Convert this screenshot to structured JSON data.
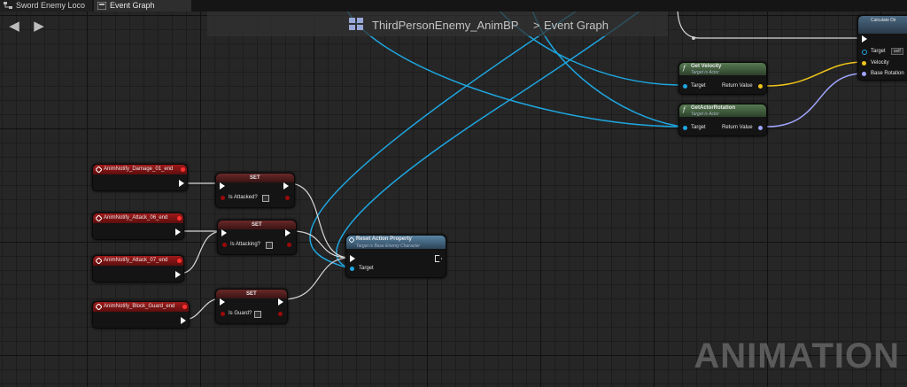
{
  "tabs": [
    {
      "label": "Sword Enemy Loco"
    },
    {
      "label": "Event Graph"
    }
  ],
  "breadcrumb": {
    "blueprint": "ThirdPersonEnemy_AnimBP",
    "separator": ">",
    "graph": "Event Graph"
  },
  "watermark": "ANIMATION",
  "nodes": {
    "events": [
      {
        "label": "AnimNotify_Damage_01_end"
      },
      {
        "label": "AnimNotify_Attack_06_end"
      },
      {
        "label": "AnimNotify_Attack_07_end"
      },
      {
        "label": "AnimNotify_Block_Guard_end"
      }
    ],
    "sets": [
      {
        "title": "SET",
        "var": "Is Attacked?"
      },
      {
        "title": "SET",
        "var": "Is Attacking?"
      },
      {
        "title": "SET",
        "var": "Is Guard?"
      }
    ],
    "reset": {
      "title": "Reset Action Property",
      "subtitle": "Target is Base Enemy Character",
      "target": "Target"
    },
    "get_velocity": {
      "icon": "f",
      "title": "Get Velocity",
      "subtitle": "Target is Actor",
      "target": "Target",
      "return": "Return Value"
    },
    "get_rotation": {
      "icon": "f",
      "title": "GetActorRotation",
      "subtitle": "Target is Actor",
      "target": "Target",
      "return": "Return Value"
    },
    "calc": {
      "title": "Calculate Dir",
      "target": "Target",
      "self": "self",
      "velocity": "Velocity",
      "base_rotation": "Base Rotation"
    }
  },
  "colors": {
    "event_header": "#8a1616",
    "set_header": "#4d1c1c",
    "func_header": "#3d5a3a",
    "reset_header": "#4a6c85",
    "object_pin": "#1ea6e0",
    "vector_pin": "#f0c419",
    "rotator_pin": "#a0a6ff",
    "bool_pin": "#9a0a0a"
  }
}
